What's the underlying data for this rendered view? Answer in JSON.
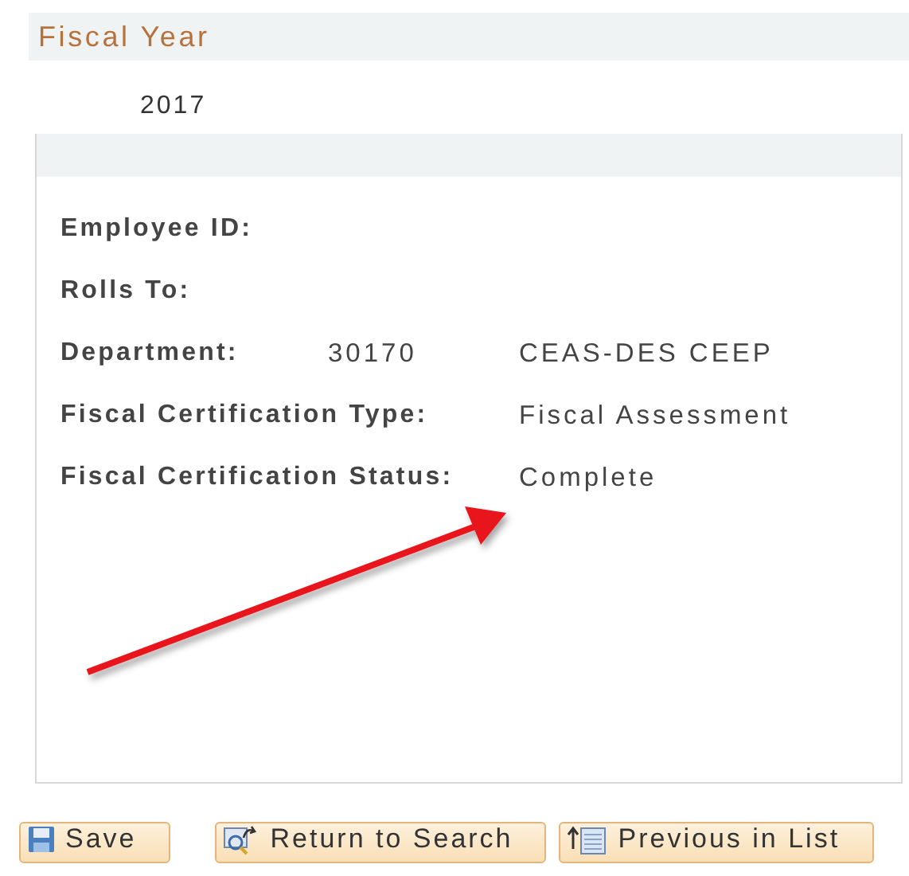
{
  "section": {
    "title": "Fiscal Year",
    "value": "2017"
  },
  "details": [
    {
      "label": "Employee ID:"
    },
    {
      "label": "Rolls To:"
    },
    {
      "label": "Department:",
      "value": "30170",
      "description": "CEAS-DES CEEP"
    },
    {
      "label": "Fiscal Certification Type:",
      "description": "Fiscal Assessment"
    },
    {
      "label": "Fiscal Certification Status:",
      "description": "Complete"
    }
  ],
  "buttons": [
    {
      "kind": "save",
      "label": "Save"
    },
    {
      "kind": "return",
      "label": "Return to Search"
    },
    {
      "kind": "previous",
      "label": "Previous in List"
    }
  ]
}
